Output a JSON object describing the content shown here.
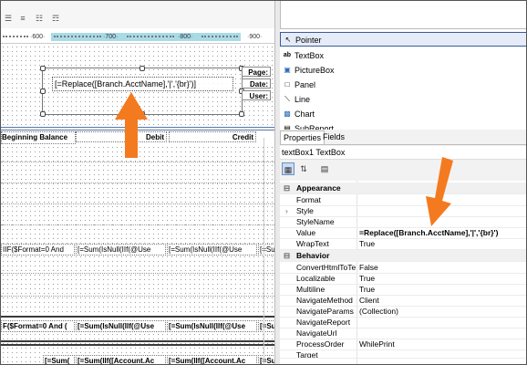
{
  "colors": {
    "arrow": "#f47a1f",
    "ruler_highlight": "#a9dbe6",
    "selected_item_border": "#3b5998"
  },
  "toolbar_icons": [
    "align-left-icon",
    "align-center-icon",
    "distribute-icon",
    "distribute-vertical-icon"
  ],
  "ruler": {
    "ticks": [
      "600",
      "700",
      "800",
      "900"
    ]
  },
  "designer": {
    "expression": "[=Replace([Branch.AcctName],'|','{br}')]",
    "labels": {
      "page": "Page:",
      "date": "Date:",
      "user": "User:"
    },
    "headers": {
      "beginning_balance": "Beginning Balance",
      "debit": "Debit",
      "credit": "Credit"
    },
    "row1": [
      "IIF($Format=0 And",
      "[=Sum(IsNull(IIf(@Use",
      "[=Sum(IsNull(IIf(@Use",
      "[=Sum(IsNull(IIf(@Use"
    ],
    "row2": [
      "F($Format=0 And (",
      "[=Sum(IsNull(IIf(@Use",
      "[=Sum(IsNull(IIf(@Use",
      "[=Sum(IsNull(IIf(@Use"
    ],
    "row3": [
      "[=Sum(",
      "[=Sum(IIf([Account.Ac",
      "[=Sum(IIf([Account.Ac",
      "[=Sum("
    ]
  },
  "toolbox": {
    "items": [
      {
        "label": "Pointer",
        "icon": "pointer-icon"
      },
      {
        "label": "TextBox",
        "icon": "textbox-icon"
      },
      {
        "label": "PictureBox",
        "icon": "picturebox-icon"
      },
      {
        "label": "Panel",
        "icon": "panel-icon"
      },
      {
        "label": "Line",
        "icon": "line-icon"
      },
      {
        "label": "Chart",
        "icon": "chart-icon"
      },
      {
        "label": "SubReport",
        "icon": "subreport-icon"
      }
    ]
  },
  "properties": {
    "tabs": [
      "Properties",
      "Fields"
    ],
    "selected_object": "textBox1 TextBox",
    "categories": {
      "appearance": "Appearance",
      "behavior": "Behavior"
    },
    "appearance_rows": [
      {
        "name": "Format",
        "value": ""
      },
      {
        "name": "Style",
        "value": ""
      },
      {
        "name": "StyleName",
        "value": ""
      },
      {
        "name": "Value",
        "value": "=Replace([Branch.AcctName],'|','{br}')"
      },
      {
        "name": "WrapText",
        "value": "True"
      }
    ],
    "behavior_rows": [
      {
        "name": "ConvertHtmlToTe",
        "value": "False"
      },
      {
        "name": "Localizable",
        "value": "True"
      },
      {
        "name": "Multiline",
        "value": "True"
      },
      {
        "name": "NavigateMethod",
        "value": "Client"
      },
      {
        "name": "NavigateParams",
        "value": "(Collection)"
      },
      {
        "name": "NavigateReport",
        "value": ""
      },
      {
        "name": "NavigateUrl",
        "value": ""
      },
      {
        "name": "ProcessOrder",
        "value": "WhilePrint"
      },
      {
        "name": "Target",
        "value": ""
      }
    ]
  }
}
